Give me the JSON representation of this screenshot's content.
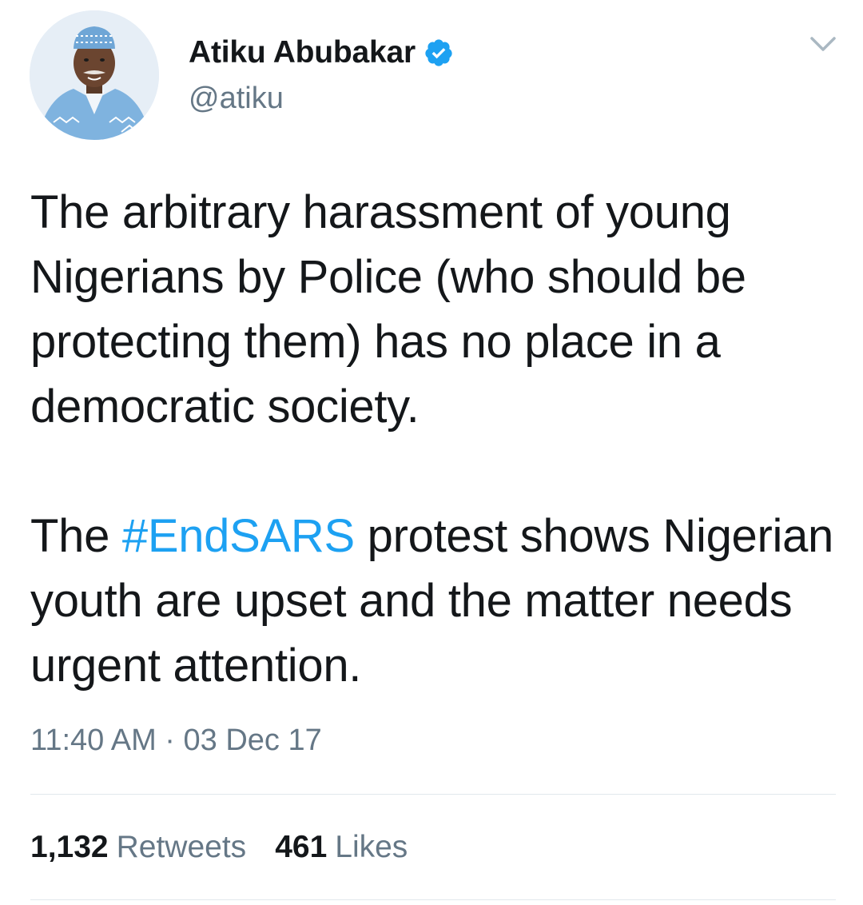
{
  "user": {
    "display_name": "Atiku Abubakar",
    "handle": "@atiku",
    "verified": true,
    "verified_icon": "verified-badge-icon",
    "avatar_icon": "profile-photo"
  },
  "menu": {
    "icon": "chevron-down-icon"
  },
  "tweet": {
    "paragraph1": "The arbitrary harassment of young Nigerians by Police (who should be protecting them) has no place in a democratic society.",
    "paragraph2_before": "The ",
    "hashtag": "#EndSARS",
    "paragraph2_after": " protest shows Nigerian youth are upset and the matter needs urgent attention."
  },
  "meta": {
    "timestamp": "11:40 AM · 03 Dec 17"
  },
  "stats": {
    "retweets_count": "1,132",
    "retweets_label": "Retweets",
    "likes_count": "461",
    "likes_label": "Likes"
  },
  "colors": {
    "link": "#1da1f2",
    "text": "#14171a",
    "secondary": "#657786",
    "divider": "#e1e8ed"
  }
}
